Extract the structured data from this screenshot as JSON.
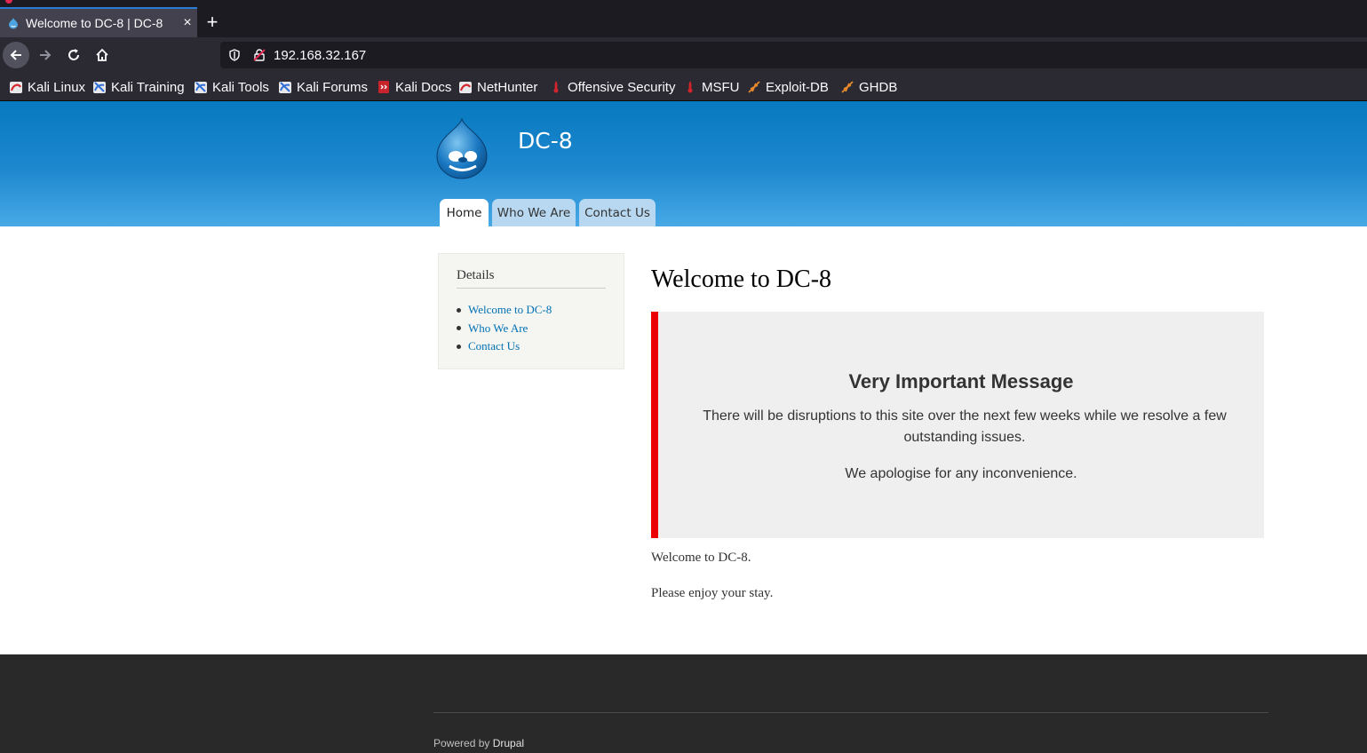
{
  "browser": {
    "tab_title": "Welcome to DC-8 | DC-8",
    "tab_close": "×",
    "new_tab": "+",
    "url": "192.168.32.167"
  },
  "bookmarks": [
    {
      "label": "Kali Linux",
      "icon": "kali-dragon-red-icon"
    },
    {
      "label": "Kali Training",
      "icon": "kali-dragon-blue-icon"
    },
    {
      "label": "Kali Tools",
      "icon": "kali-dragon-blue-icon"
    },
    {
      "label": "Kali Forums",
      "icon": "kali-dragon-blue-icon"
    },
    {
      "label": "Kali Docs",
      "icon": "kali-docs-red-icon"
    },
    {
      "label": "NetHunter",
      "icon": "kali-dragon-red-icon"
    },
    {
      "label": "Offensive Security",
      "icon": "offsec-red-icon"
    },
    {
      "label": "MSFU",
      "icon": "offsec-red-icon"
    },
    {
      "label": "Exploit-DB",
      "icon": "exploit-db-orange-icon"
    },
    {
      "label": "GHDB",
      "icon": "exploit-db-orange-icon"
    }
  ],
  "site": {
    "name": "DC-8",
    "main_menu": [
      "Home",
      "Who We Are",
      "Contact Us"
    ],
    "active_menu": "Home"
  },
  "sidebar": {
    "title": "Details",
    "links": [
      "Welcome to DC-8",
      "Who We Are",
      "Contact Us"
    ]
  },
  "content": {
    "title": "Welcome to DC-8",
    "alert_heading": "Very Important Message",
    "alert_line1": "There will be disruptions to this site over the next few weeks while we resolve a few outstanding issues.",
    "alert_line2": "We apologise for any inconvenience.",
    "paragraph1": "Welcome to DC-8.",
    "paragraph2": "Please enjoy your stay."
  },
  "footer": {
    "powered_prefix": "Powered by",
    "powered_link": "Drupal"
  },
  "colors": {
    "header_blue": "#0779bf",
    "alert_border": "#ea0000",
    "link": "#0071b3",
    "footer_bg": "#292929"
  }
}
